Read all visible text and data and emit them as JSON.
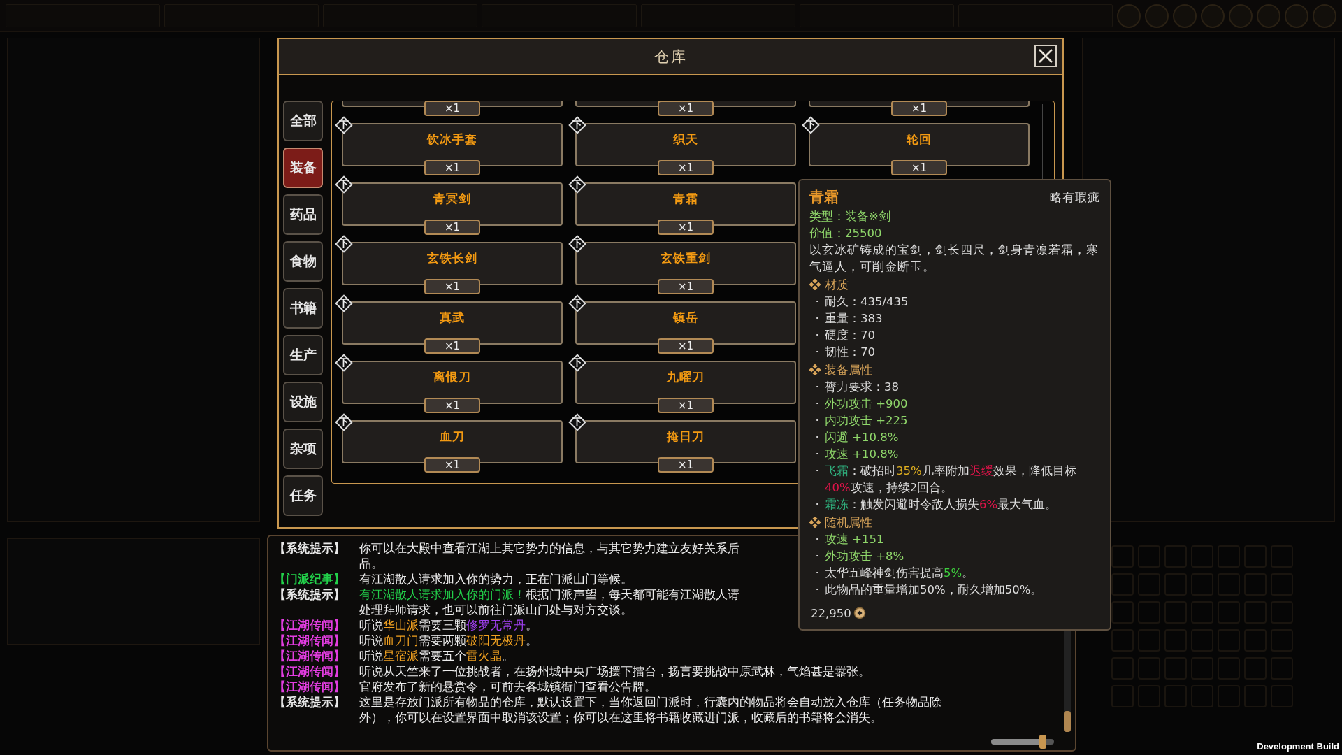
{
  "dialog": {
    "title": "仓库"
  },
  "tabs": [
    {
      "label": "全部",
      "selected": false
    },
    {
      "label": "装备",
      "selected": true
    },
    {
      "label": "药品",
      "selected": false
    },
    {
      "label": "食物",
      "selected": false
    },
    {
      "label": "书籍",
      "selected": false
    },
    {
      "label": "生产",
      "selected": false
    },
    {
      "label": "设施",
      "selected": false
    },
    {
      "label": "杂项",
      "selected": false
    },
    {
      "label": "任务",
      "selected": false
    }
  ],
  "grid_rows": [
    {
      "cells": [
        {
          "count": "×1"
        },
        {
          "count": "×1"
        },
        {
          "count": "×1"
        }
      ]
    },
    {
      "cells": [
        {
          "mark": "下",
          "name": "饮冰手套",
          "count": "×1"
        },
        {
          "mark": "下",
          "name": "织天",
          "count": "×1"
        },
        {
          "mark": "下",
          "name": "轮回",
          "count": "×1"
        }
      ]
    },
    {
      "cells": [
        {
          "mark": "下",
          "name": "青冥剑",
          "count": "×1"
        },
        {
          "mark": "下",
          "name": "青霜",
          "count": "×1"
        }
      ]
    },
    {
      "cells": [
        {
          "mark": "下",
          "name": "玄铁长剑",
          "count": "×1"
        },
        {
          "mark": "下",
          "name": "玄铁重剑",
          "count": "×1"
        }
      ]
    },
    {
      "cells": [
        {
          "mark": "下",
          "name": "真武",
          "count": "×1"
        },
        {
          "mark": "下",
          "name": "镇岳",
          "count": "×1"
        }
      ]
    },
    {
      "cells": [
        {
          "mark": "下",
          "name": "离恨刀",
          "count": "×1"
        },
        {
          "mark": "下",
          "name": "九曜刀",
          "count": "×1"
        }
      ]
    },
    {
      "cells": [
        {
          "mark": "下",
          "name": "血刀",
          "count": "×1"
        },
        {
          "mark": "下",
          "name": "掩日刀",
          "count": "×1"
        }
      ]
    }
  ],
  "tooltip": {
    "title": "青霜",
    "quality": "略有瑕疵",
    "header_lines": [
      {
        "parts": [
          {
            "text": "类型：装备※剑",
            "color": "#8fd66a"
          }
        ]
      },
      {
        "parts": [
          {
            "text": "价值：25500",
            "color": "#8fd66a"
          }
        ]
      }
    ],
    "description": "以玄冰矿铸成的宝剑，剑长四尺，剑身青凛若霜，寒气逼人，可削金断玉。",
    "sections": [
      {
        "title": "材质",
        "lines": [
          {
            "bullet": "·",
            "parts": [
              {
                "text": "耐久：435/435"
              }
            ]
          },
          {
            "bullet": "·",
            "parts": [
              {
                "text": "重量：383"
              }
            ]
          },
          {
            "bullet": "·",
            "parts": [
              {
                "text": "硬度：70"
              }
            ]
          },
          {
            "bullet": "·",
            "parts": [
              {
                "text": "韧性：70"
              }
            ]
          }
        ]
      },
      {
        "title": "装备属性",
        "lines": [
          {
            "bullet": "·",
            "parts": [
              {
                "text": "膂力要求：38"
              }
            ]
          },
          {
            "bullet": "·",
            "parts": [
              {
                "text": "外功攻击 +900",
                "color": "#8fd66a"
              }
            ]
          },
          {
            "bullet": "·",
            "parts": [
              {
                "text": "内功攻击 +225",
                "color": "#8fd66a"
              }
            ]
          },
          {
            "bullet": "·",
            "parts": [
              {
                "text": "闪避 +10.8%",
                "color": "#8fd66a"
              }
            ]
          },
          {
            "bullet": "·",
            "parts": [
              {
                "text": "攻速 +10.8%",
                "color": "#8fd66a"
              }
            ]
          },
          {
            "bullet": "·",
            "parts": [
              {
                "text": "飞霜",
                "color": "#2fae7c"
              },
              {
                "text": "：破招时"
              },
              {
                "text": "35%",
                "color": "#e0b020"
              },
              {
                "text": "几率附加"
              },
              {
                "text": "迟缓",
                "color": "#e0144a"
              },
              {
                "text": "效果，降低目标"
              },
              {
                "text": "40%",
                "color": "#e0144a"
              },
              {
                "text": "攻速，持续2回合。"
              }
            ]
          },
          {
            "bullet": "·",
            "parts": [
              {
                "text": "霜冻",
                "color": "#2fae7c"
              },
              {
                "text": "：触发闪避时令敌人损失"
              },
              {
                "text": "6%",
                "color": "#e0144a"
              },
              {
                "text": "最大气血。"
              }
            ]
          }
        ]
      },
      {
        "title": "随机属性",
        "lines": [
          {
            "bullet": "·",
            "parts": [
              {
                "text": "攻速 +151",
                "color": "#8fd66a"
              }
            ]
          },
          {
            "bullet": "·",
            "parts": [
              {
                "text": "外功攻击 +8%",
                "color": "#8fd66a"
              }
            ]
          },
          {
            "bullet": "·",
            "parts": [
              {
                "text": "太华五峰神剑伤害提高"
              },
              {
                "text": "5%",
                "color": "#3ecf3e"
              },
              {
                "text": "。"
              }
            ]
          },
          {
            "bullet": "·",
            "parts": [
              {
                "text": "此物品的重量增加50%，耐久增加50%。"
              }
            ]
          }
        ]
      }
    ],
    "price": "22,950"
  },
  "log": {
    "rows": [
      {
        "tag": {
          "text": "【系统提示】",
          "color": "#e8e8e8"
        },
        "parts": [
          {
            "text": "你可以在大殿中查看江湖上其它势力的信息，与其它势力建立友好关系后"
          }
        ]
      },
      {
        "parts": [
          {
            "text": "品。"
          }
        ]
      },
      {
        "tag": {
          "text": "【门派纪事】",
          "color": "#22d04a"
        },
        "parts": [
          {
            "text": "有江湖散人请求加入你的势力，正在门派山门等候。"
          }
        ]
      },
      {
        "tag": {
          "text": "【系统提示】",
          "color": "#e8e8e8"
        },
        "parts": [
          {
            "text": "有江湖散人请求加入你的门派！",
            "color": "#22d04a"
          },
          {
            "text": "根据门派声望，每天都可能有江湖散人请"
          }
        ]
      },
      {
        "parts": [
          {
            "text": "处理拜师请求，也可以前往门派山门处与对方交谈。"
          }
        ]
      },
      {
        "tag": {
          "text": "【江湖传闻】",
          "color": "#e23de0"
        },
        "parts": [
          {
            "text": "听说"
          },
          {
            "text": "华山派",
            "color": "#f0a020"
          },
          {
            "text": "需要三颗"
          },
          {
            "text": "修罗无常丹",
            "color": "#a040f0"
          },
          {
            "text": "。"
          }
        ]
      },
      {
        "tag": {
          "text": "【江湖传闻】",
          "color": "#e23de0"
        },
        "parts": [
          {
            "text": "听说"
          },
          {
            "text": "血刀门",
            "color": "#f0a020"
          },
          {
            "text": "需要两颗"
          },
          {
            "text": "破阳无极丹",
            "color": "#f0a020"
          },
          {
            "text": "。"
          }
        ]
      },
      {
        "tag": {
          "text": "【江湖传闻】",
          "color": "#e23de0"
        },
        "parts": [
          {
            "text": "听说"
          },
          {
            "text": "星宿派",
            "color": "#f0a020"
          },
          {
            "text": "需要五个"
          },
          {
            "text": "雷火晶",
            "color": "#f0a020"
          },
          {
            "text": "。"
          }
        ]
      },
      {
        "tag": {
          "text": "【江湖传闻】",
          "color": "#e23de0"
        },
        "parts": [
          {
            "text": "听说从天竺来了一位挑战者，在扬州城中央广场摆下擂台，扬言要挑战中原武林，气焰甚是嚣张。"
          }
        ]
      },
      {
        "tag": {
          "text": "【江湖传闻】",
          "color": "#e23de0"
        },
        "parts": [
          {
            "text": "官府发布了新的悬赏令，可前去各城镇衙门查看公告牌。"
          }
        ]
      },
      {
        "tag": {
          "text": "【系统提示】",
          "color": "#e8e8e8"
        },
        "parts": [
          {
            "text": "这里是存放门派所有物品的仓库，默认设置下，当你返回门派时，行囊内的物品将会自动放入仓库（任务物品除"
          }
        ]
      },
      {
        "parts": [
          {
            "text": "外），你可以在设置界面中取消该设置；你可以在这里将书籍收藏进门派，收藏后的书籍将会消失。"
          }
        ]
      }
    ],
    "zoom_slider": {
      "level": 0.82
    }
  },
  "build_label": "Development Build"
}
